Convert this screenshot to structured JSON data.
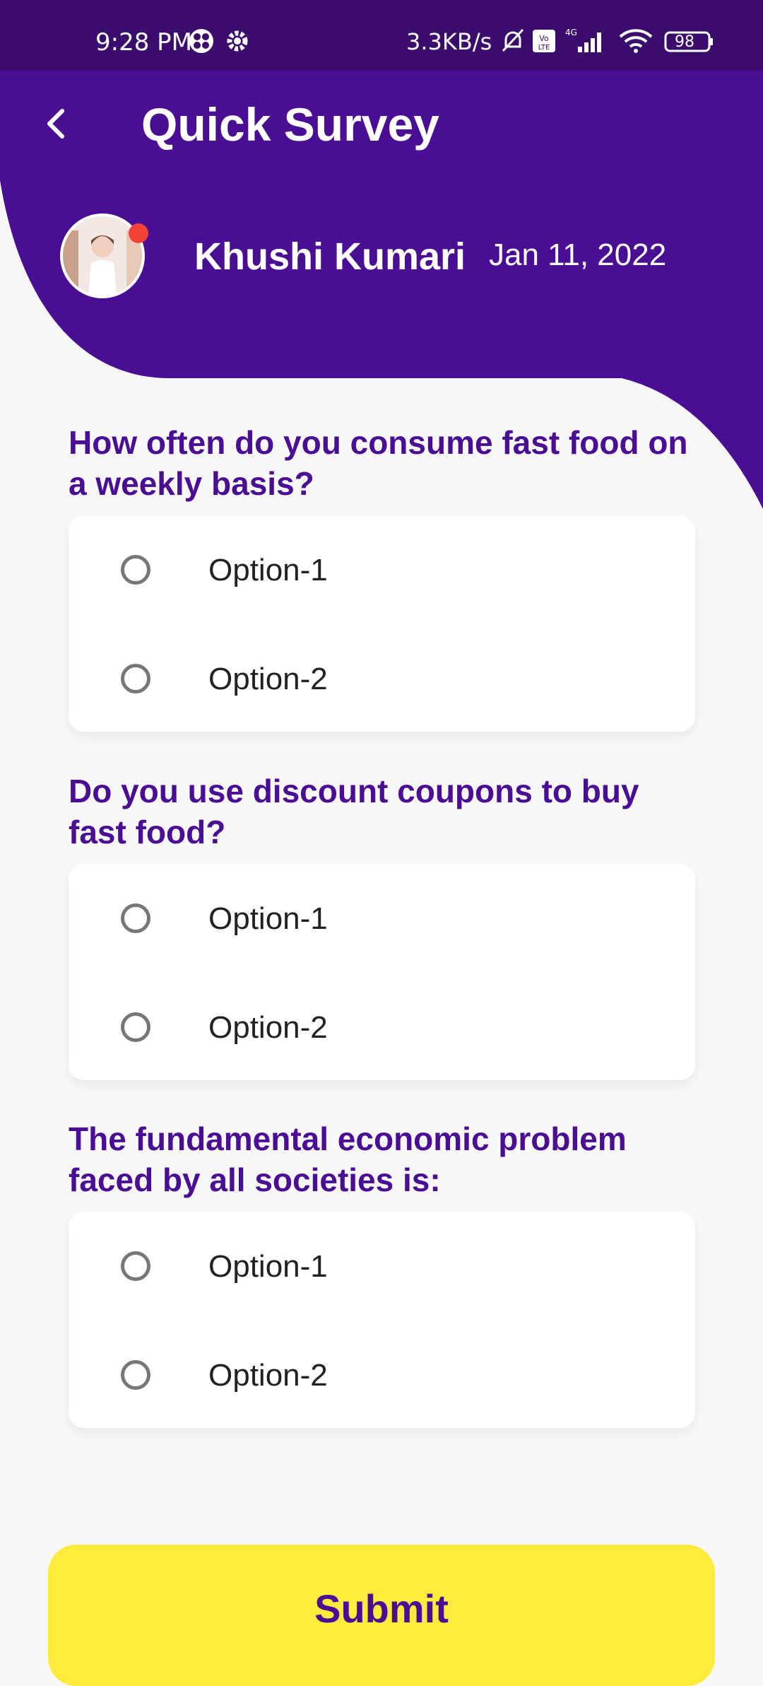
{
  "status_bar": {
    "time": "9:28 PM",
    "speed": "3.3KB/s",
    "battery": "98"
  },
  "header": {
    "title": "Quick Survey",
    "user_name": "Khushi Kumari",
    "date": "Jan 11, 2022"
  },
  "questions": [
    {
      "text": "How often do you consume fast food on a weekly basis?",
      "options": [
        "Option-1",
        "Option-2"
      ]
    },
    {
      "text": "Do you use discount coupons to buy fast food?",
      "options": [
        "Option-1",
        "Option-2"
      ]
    },
    {
      "text": "The fundamental economic problem faced by all societies is:",
      "options": [
        "Option-1",
        "Option-2"
      ]
    }
  ],
  "submit_label": "Submit",
  "colors": {
    "header": "#4a0e94",
    "status_bar": "#3a0c6b",
    "accent_yellow": "#ffeb3b",
    "notification_dot": "#f44336"
  }
}
